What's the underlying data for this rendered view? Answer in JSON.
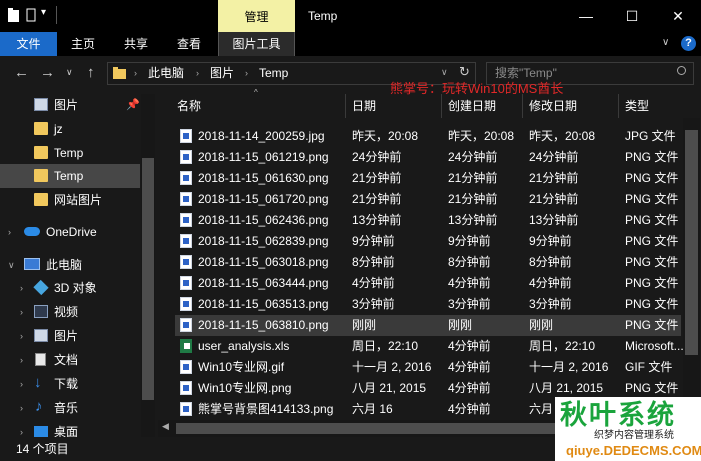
{
  "titlebar": {
    "manage_tab": "管理",
    "window_title": "Temp",
    "minimize_glyph": "—",
    "maximize_glyph": "☐",
    "close_glyph": "✕"
  },
  "ribbon": {
    "file": "文件",
    "home": "主页",
    "share": "共享",
    "view": "查看",
    "picture_tools": "图片工具",
    "help": "?"
  },
  "address": {
    "crumbs": [
      "此电脑",
      "图片",
      "Temp"
    ],
    "search_placeholder": "搜索\"Temp\""
  },
  "watermark_text": "熊掌号：玩转Win10的MS酋长",
  "nav": {
    "items": [
      {
        "label": "图片",
        "icon": "pictures-icon"
      },
      {
        "label": "jz",
        "icon": "folder-icon"
      },
      {
        "label": "Temp",
        "icon": "folder-icon"
      },
      {
        "label": "Temp",
        "icon": "folder-icon"
      },
      {
        "label": "网站图片",
        "icon": "folder-icon"
      },
      {
        "label": "OneDrive",
        "icon": "onedrive-icon"
      },
      {
        "label": "此电脑",
        "icon": "computer-icon"
      },
      {
        "label": "3D 对象",
        "icon": "3d-objects-icon"
      },
      {
        "label": "视频",
        "icon": "videos-icon"
      },
      {
        "label": "图片",
        "icon": "pictures-icon"
      },
      {
        "label": "文档",
        "icon": "documents-icon"
      },
      {
        "label": "下载",
        "icon": "downloads-icon"
      },
      {
        "label": "音乐",
        "icon": "music-icon"
      },
      {
        "label": "桌面",
        "icon": "desktop-icon"
      }
    ]
  },
  "columns": [
    "名称",
    "日期",
    "创建日期",
    "修改日期",
    "类型"
  ],
  "files": [
    {
      "name": "2018-11-14_200259.jpg",
      "date": "昨天，20:08",
      "created": "昨天，20:08",
      "modified": "昨天，20:08",
      "type": "JPG 文件",
      "kind": "image"
    },
    {
      "name": "2018-11-15_061219.png",
      "date": "24分钟前",
      "created": "24分钟前",
      "modified": "24分钟前",
      "type": "PNG 文件",
      "kind": "image"
    },
    {
      "name": "2018-11-15_061630.png",
      "date": "21分钟前",
      "created": "21分钟前",
      "modified": "21分钟前",
      "type": "PNG 文件",
      "kind": "image"
    },
    {
      "name": "2018-11-15_061720.png",
      "date": "21分钟前",
      "created": "21分钟前",
      "modified": "21分钟前",
      "type": "PNG 文件",
      "kind": "image"
    },
    {
      "name": "2018-11-15_062436.png",
      "date": "13分钟前",
      "created": "13分钟前",
      "modified": "13分钟前",
      "type": "PNG 文件",
      "kind": "image"
    },
    {
      "name": "2018-11-15_062839.png",
      "date": "9分钟前",
      "created": "9分钟前",
      "modified": "9分钟前",
      "type": "PNG 文件",
      "kind": "image"
    },
    {
      "name": "2018-11-15_063018.png",
      "date": "8分钟前",
      "created": "8分钟前",
      "modified": "8分钟前",
      "type": "PNG 文件",
      "kind": "image"
    },
    {
      "name": "2018-11-15_063444.png",
      "date": "4分钟前",
      "created": "4分钟前",
      "modified": "4分钟前",
      "type": "PNG 文件",
      "kind": "image"
    },
    {
      "name": "2018-11-15_063513.png",
      "date": "3分钟前",
      "created": "3分钟前",
      "modified": "3分钟前",
      "type": "PNG 文件",
      "kind": "image"
    },
    {
      "name": "2018-11-15_063810.png",
      "date": "刚刚",
      "created": "刚刚",
      "modified": "刚刚",
      "type": "PNG 文件",
      "kind": "image"
    },
    {
      "name": "user_analysis.xls",
      "date": "周日，22:10",
      "created": "4分钟前",
      "modified": "周日，22:10",
      "type": "Microsoft...",
      "kind": "xls"
    },
    {
      "name": "Win10专业网.gif",
      "date": "十一月 2, 2016",
      "created": "4分钟前",
      "modified": "十一月 2, 2016",
      "type": "GIF 文件",
      "kind": "image"
    },
    {
      "name": "Win10专业网.png",
      "date": "八月 21, 2015",
      "created": "4分钟前",
      "modified": "八月 21, 2015",
      "type": "PNG 文件",
      "kind": "image"
    },
    {
      "name": "熊掌号背景图414133.png",
      "date": "六月 16",
      "created": "4分钟前",
      "modified": "六月",
      "type": "",
      "kind": "image"
    }
  ],
  "status": "14 个项目",
  "logo": {
    "main": "秋叶系统",
    "sub": "织梦内容管理系统",
    "domain": "qiuye.DEDECMS.COM"
  }
}
